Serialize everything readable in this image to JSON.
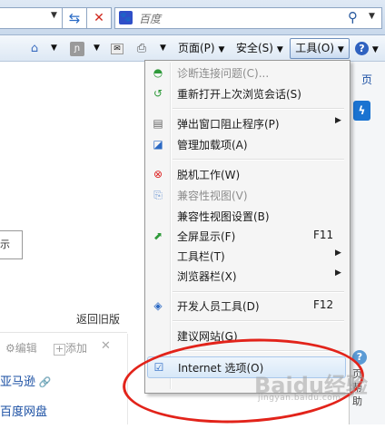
{
  "search": {
    "placeholder": "百度"
  },
  "commandbar": {
    "page_label": "页面(P)",
    "safety_label": "安全(S)",
    "tools_label": "工具(O)"
  },
  "page": {
    "back_old": "返回旧版",
    "edit": "编辑",
    "add": "添加",
    "amazon": "亚马逊",
    "baidupan": "百度网盘",
    "right_text": "页",
    "side_help": [
      "页",
      "帮",
      "助"
    ],
    "faint_box": "示"
  },
  "menu": {
    "items": [
      {
        "label": "诊断连接问题(C)...",
        "disabled": true,
        "icon": "diagnose-icon"
      },
      {
        "label": "重新打开上次浏览会话(S)",
        "icon": "reopen-session-icon"
      },
      {
        "label": "弹出窗口阻止程序(P)",
        "submenu": true,
        "icon": "popup-blocker-icon"
      },
      {
        "label": "管理加载项(A)",
        "icon": "manage-addons-icon"
      },
      {
        "label": "脱机工作(W)",
        "icon": "work-offline-icon"
      },
      {
        "label": "兼容性视图(V)",
        "disabled": true,
        "icon": "compat-view-icon"
      },
      {
        "label": "兼容性视图设置(B)"
      },
      {
        "label": "全屏显示(F)",
        "shortcut": "F11",
        "icon": "fullscreen-icon"
      },
      {
        "label": "工具栏(T)",
        "submenu": true
      },
      {
        "label": "浏览器栏(X)",
        "submenu": true
      },
      {
        "label": "开发人员工具(D)",
        "shortcut": "F12",
        "icon": "developer-tools-icon"
      },
      {
        "label": "建议网站(G)"
      },
      {
        "label": "Internet 选项(O)",
        "icon": "internet-options-icon",
        "highlighted": true
      }
    ]
  },
  "watermark": {
    "text": "Baidu经验",
    "sub": "jingyan.baidu.com"
  },
  "colors": {
    "annotation": "#e2231a",
    "menu_bg": "#f5f5f5",
    "tools_border": "#6d8fbd"
  }
}
